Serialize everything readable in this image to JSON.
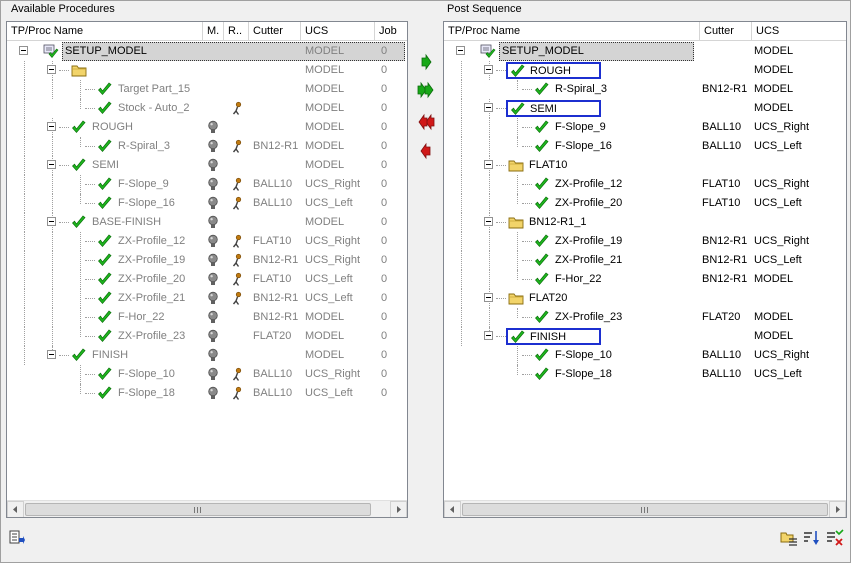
{
  "window": {
    "available_label": "Available Procedures",
    "post_label": "Post Sequence"
  },
  "left": {
    "headers": [
      "TP/Proc Name",
      "M.",
      "R..",
      "Cutter",
      "UCS",
      "Job"
    ],
    "rows": [
      {
        "name": "SETUP_MODEL",
        "cutter": "",
        "ucs": "MODEL",
        "job": "0",
        "m": false,
        "r": false
      },
      {
        "name": "",
        "cutter": "",
        "ucs": "MODEL",
        "job": "0",
        "m": false,
        "r": false
      },
      {
        "name": "Target Part_15",
        "cutter": "",
        "ucs": "MODEL",
        "job": "0",
        "m": false,
        "r": false
      },
      {
        "name": "Stock - Auto_2",
        "cutter": "",
        "ucs": "MODEL",
        "job": "0",
        "m": false,
        "r": true
      },
      {
        "name": "ROUGH",
        "cutter": "",
        "ucs": "MODEL",
        "job": "0",
        "m": true,
        "r": false
      },
      {
        "name": "R-Spiral_3",
        "cutter": "BN12-R1",
        "ucs": "MODEL",
        "job": "0",
        "m": true,
        "r": true
      },
      {
        "name": "SEMI",
        "cutter": "",
        "ucs": "MODEL",
        "job": "0",
        "m": true,
        "r": false
      },
      {
        "name": "F-Slope_9",
        "cutter": "BALL10",
        "ucs": "UCS_Right",
        "job": "0",
        "m": true,
        "r": true
      },
      {
        "name": "F-Slope_16",
        "cutter": "BALL10",
        "ucs": "UCS_Left",
        "job": "0",
        "m": true,
        "r": true
      },
      {
        "name": "BASE-FINISH",
        "cutter": "",
        "ucs": "MODEL",
        "job": "0",
        "m": true,
        "r": false
      },
      {
        "name": "ZX-Profile_12",
        "cutter": "FLAT10",
        "ucs": "UCS_Right",
        "job": "0",
        "m": true,
        "r": true
      },
      {
        "name": "ZX-Profile_19",
        "cutter": "BN12-R1",
        "ucs": "UCS_Right",
        "job": "0",
        "m": true,
        "r": true
      },
      {
        "name": "ZX-Profile_20",
        "cutter": "FLAT10",
        "ucs": "UCS_Left",
        "job": "0",
        "m": true,
        "r": true
      },
      {
        "name": "ZX-Profile_21",
        "cutter": "BN12-R1",
        "ucs": "UCS_Left",
        "job": "0",
        "m": true,
        "r": true
      },
      {
        "name": "F-Hor_22",
        "cutter": "BN12-R1",
        "ucs": "MODEL",
        "job": "0",
        "m": true,
        "r": false
      },
      {
        "name": "ZX-Profile_23",
        "cutter": "FLAT20",
        "ucs": "MODEL",
        "job": "0",
        "m": true,
        "r": false
      },
      {
        "name": "FINISH",
        "cutter": "",
        "ucs": "MODEL",
        "job": "0",
        "m": true,
        "r": false
      },
      {
        "name": "F-Slope_10",
        "cutter": "BALL10",
        "ucs": "UCS_Right",
        "job": "0",
        "m": true,
        "r": true
      },
      {
        "name": "F-Slope_18",
        "cutter": "BALL10",
        "ucs": "UCS_Left",
        "job": "0",
        "m": true,
        "r": true
      }
    ]
  },
  "right": {
    "headers": [
      "TP/Proc Name",
      "Cutter",
      "UCS"
    ],
    "rows": [
      {
        "name": "SETUP_MODEL",
        "cutter": "",
        "ucs": "MODEL"
      },
      {
        "name": "ROUGH",
        "cutter": "",
        "ucs": "MODEL"
      },
      {
        "name": "R-Spiral_3",
        "cutter": "BN12-R1",
        "ucs": "MODEL"
      },
      {
        "name": "SEMI",
        "cutter": "",
        "ucs": "MODEL"
      },
      {
        "name": "F-Slope_9",
        "cutter": "BALL10",
        "ucs": "UCS_Right"
      },
      {
        "name": "F-Slope_16",
        "cutter": "BALL10",
        "ucs": "UCS_Left"
      },
      {
        "name": "FLAT10",
        "cutter": "",
        "ucs": ""
      },
      {
        "name": "ZX-Profile_12",
        "cutter": "FLAT10",
        "ucs": "UCS_Right"
      },
      {
        "name": "ZX-Profile_20",
        "cutter": "FLAT10",
        "ucs": "UCS_Left"
      },
      {
        "name": "BN12-R1_1",
        "cutter": "",
        "ucs": ""
      },
      {
        "name": "ZX-Profile_19",
        "cutter": "BN12-R1",
        "ucs": "UCS_Right"
      },
      {
        "name": "ZX-Profile_21",
        "cutter": "BN12-R1",
        "ucs": "UCS_Left"
      },
      {
        "name": "F-Hor_22",
        "cutter": "BN12-R1",
        "ucs": "MODEL"
      },
      {
        "name": "FLAT20",
        "cutter": "",
        "ucs": ""
      },
      {
        "name": "ZX-Profile_23",
        "cutter": "FLAT20",
        "ucs": "MODEL"
      },
      {
        "name": "FINISH",
        "cutter": "",
        "ucs": "MODEL"
      },
      {
        "name": "F-Slope_10",
        "cutter": "BALL10",
        "ucs": "UCS_Right"
      },
      {
        "name": "F-Slope_18",
        "cutter": "BALL10",
        "ucs": "UCS_Left"
      }
    ]
  },
  "colors": {
    "check_green": "#1fb81f",
    "highlight_blue": "#1c2fd0",
    "folder_yellow": "#f2d46a",
    "arrow_green": "#18a818",
    "arrow_red": "#d01818"
  },
  "icons": {
    "move_right": "arrow-right-green-icon",
    "move_all_right": "double-arrow-right-green-icon",
    "move_all_left": "double-arrow-left-red-icon",
    "move_left": "arrow-left-red-icon"
  }
}
